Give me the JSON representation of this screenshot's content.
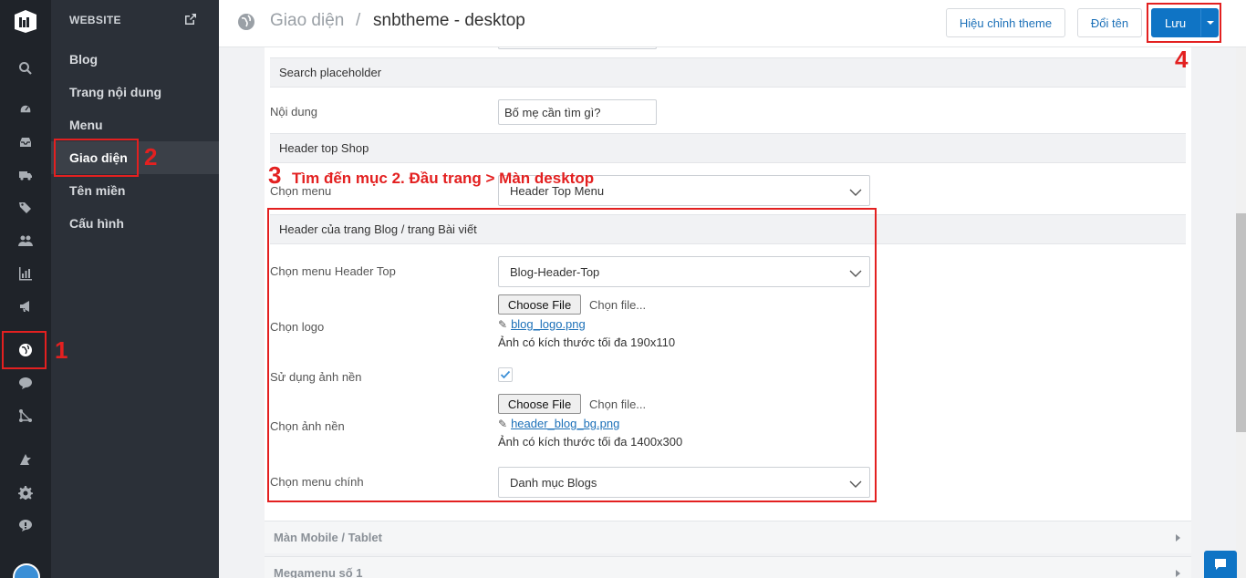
{
  "rail": {
    "icons": [
      "search-icon",
      "dashboard-icon",
      "inbox-icon",
      "truck-icon",
      "tags-icon",
      "users-icon",
      "chart-icon",
      "megaphone-icon",
      "globe-icon",
      "chat-icon",
      "flow-icon",
      "apps-icon",
      "gear-icon",
      "support-icon"
    ]
  },
  "sidebar": {
    "title": "WEBSITE",
    "items": [
      {
        "label": "Blog"
      },
      {
        "label": "Trang nội dung"
      },
      {
        "label": "Menu"
      },
      {
        "label": "Giao diện"
      },
      {
        "label": "Tên miền"
      },
      {
        "label": "Cấu hình"
      }
    ]
  },
  "header": {
    "crumb": "Giao diện",
    "separator": "/",
    "title": "snbtheme - desktop",
    "edit_theme": "Hiệu chỉnh theme",
    "rename": "Đổi tên",
    "save": "Lưu"
  },
  "form": {
    "search_section": "Search placeholder",
    "content_label": "Nội dung",
    "content_value": "Bố mẹ cần tìm gì?",
    "header_top_section": "Header top Shop",
    "choose_menu_label": "Chọn menu",
    "choose_menu_value": "Header Top Menu",
    "blog_section": "Header của trang Blog / trang Bài viết",
    "blog_menu_label": "Chọn menu Header Top",
    "blog_menu_value": "Blog-Header-Top",
    "logo_label": "Chọn logo",
    "choose_file": "Choose File",
    "choose_file_text": "Chọn file...",
    "logo_file": "blog_logo.png",
    "logo_hint": "Ảnh có kích thước tối đa 190x110",
    "bg_use_label": "Sử dụng ảnh nền",
    "bg_use_checked": true,
    "bg_label": "Chọn ảnh nền",
    "bg_file": "header_blog_bg.png",
    "bg_hint": "Ảnh có kích thước tối đa 1400x300",
    "main_menu_label": "Chọn menu chính",
    "main_menu_value": "Danh mục Blogs"
  },
  "collapsed": [
    {
      "label": "Màn Mobile / Tablet"
    },
    {
      "label": "Megamenu số 1"
    }
  ],
  "annotations": {
    "n1": "1",
    "n2": "2",
    "n3": "3",
    "n4": "4",
    "step3_text": "Tìm đến mục 2. Đầu trang > Màn desktop",
    "color": "#e32020"
  }
}
